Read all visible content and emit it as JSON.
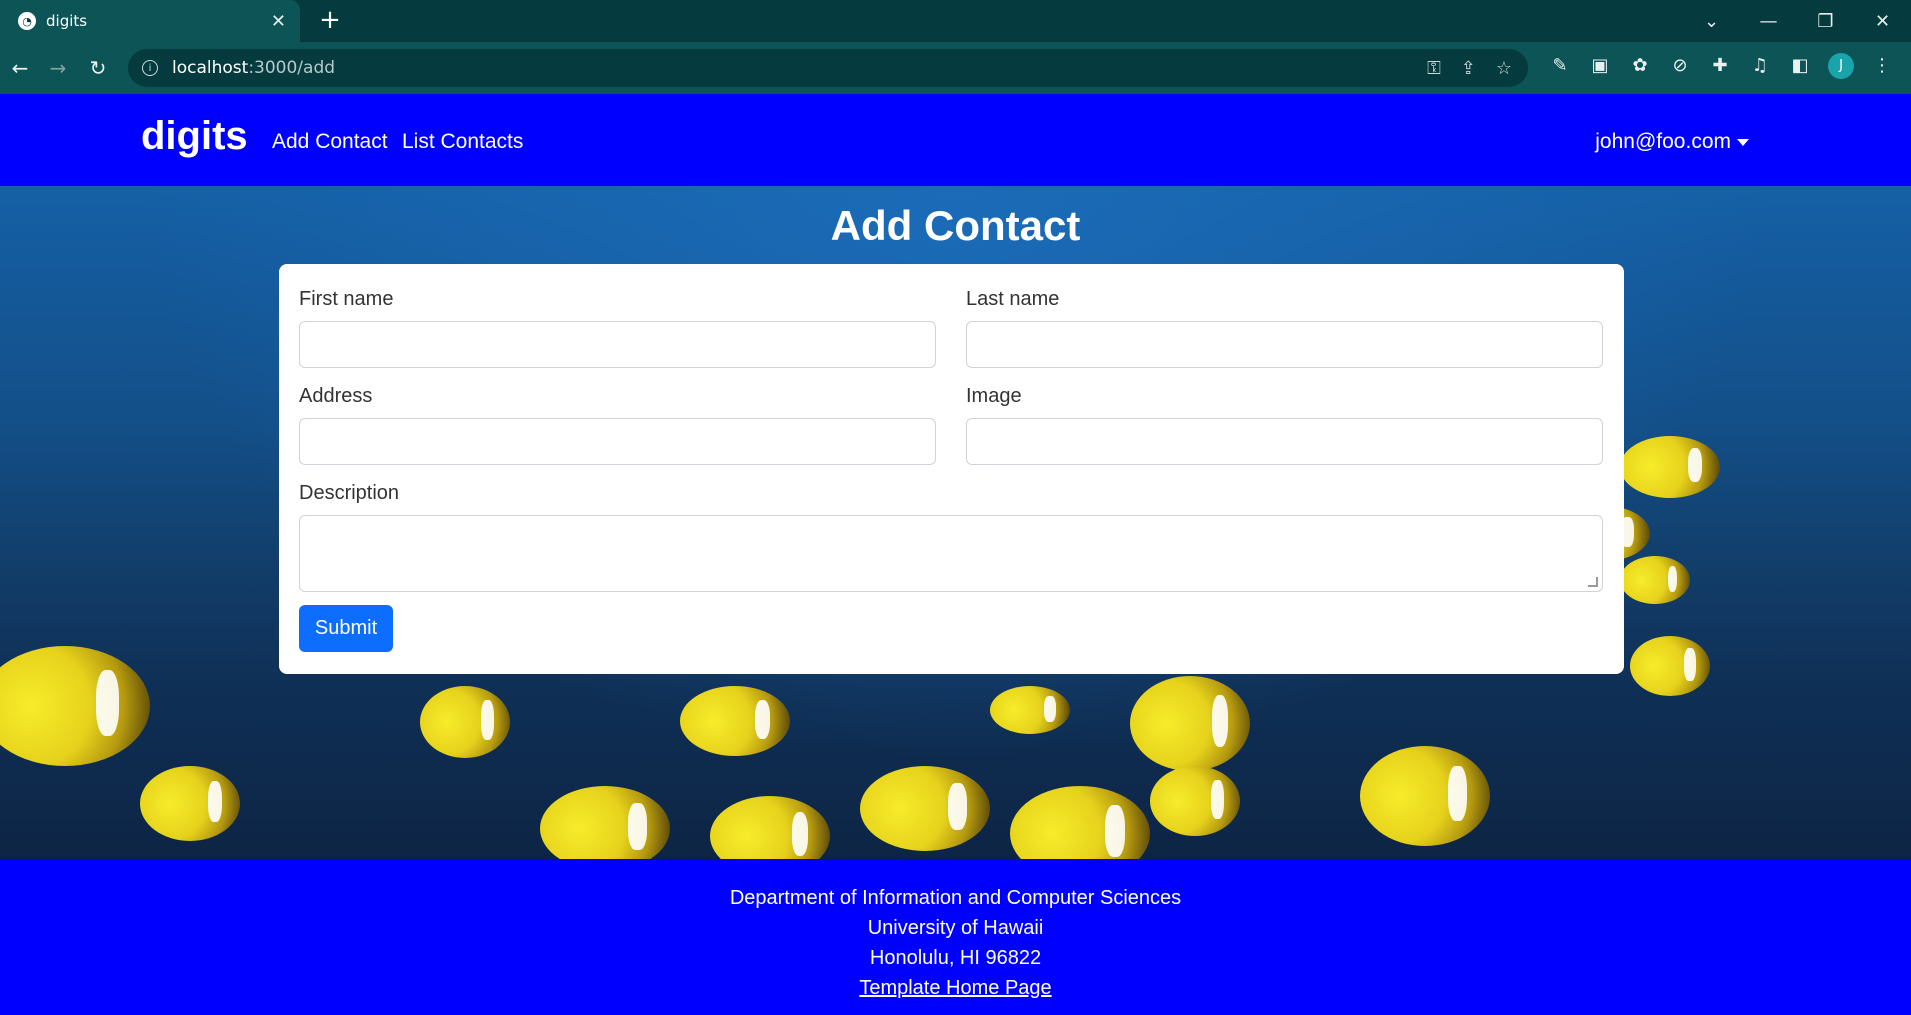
{
  "browser": {
    "tab_title": "digits",
    "url_host": "localhost",
    "url_path": ":3000/add",
    "profile_initial": "J"
  },
  "navbar": {
    "brand": "digits",
    "links": [
      "Add Contact",
      "List Contacts"
    ],
    "user": "john@foo.com"
  },
  "page": {
    "title": "Add Contact"
  },
  "form": {
    "first_name_label": "First name",
    "last_name_label": "Last name",
    "address_label": "Address",
    "image_label": "Image",
    "description_label": "Description",
    "submit_label": "Submit",
    "first_name_value": "",
    "last_name_value": "",
    "address_value": "",
    "image_value": "",
    "description_value": ""
  },
  "footer": {
    "line1": "Department of Information and Computer Sciences",
    "line2": "University of Hawaii",
    "line3": "Honolulu, HI 96822",
    "link": "Template Home Page"
  }
}
